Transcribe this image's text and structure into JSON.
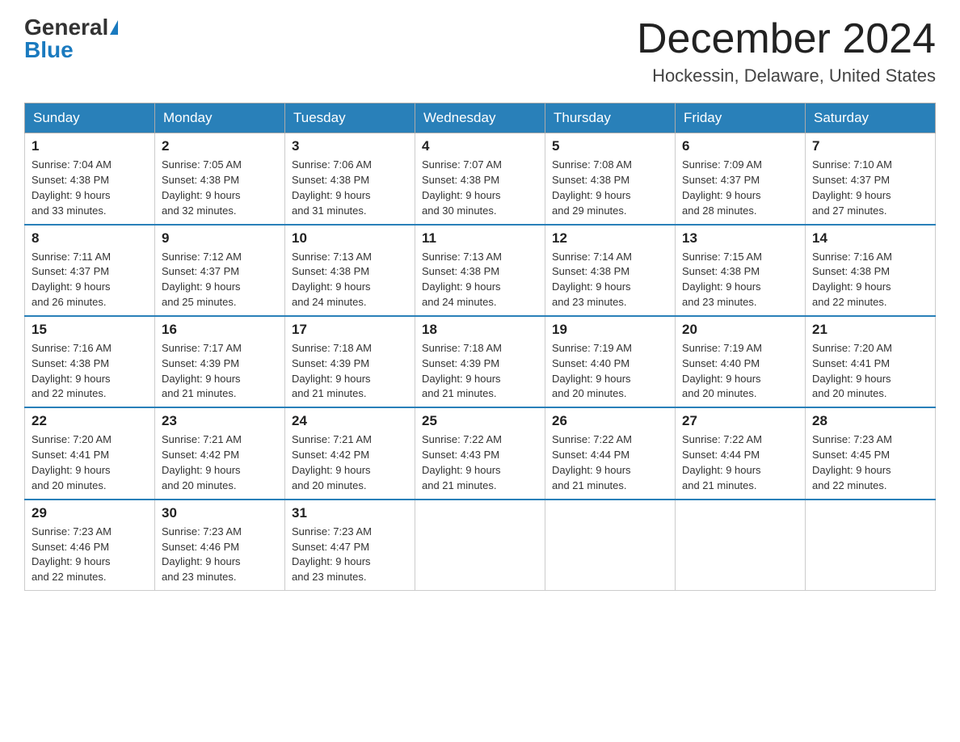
{
  "header": {
    "logo_general": "General",
    "logo_blue": "Blue",
    "month_title": "December 2024",
    "location": "Hockessin, Delaware, United States"
  },
  "weekdays": [
    "Sunday",
    "Monday",
    "Tuesday",
    "Wednesday",
    "Thursday",
    "Friday",
    "Saturday"
  ],
  "weeks": [
    [
      {
        "day": "1",
        "sunrise": "7:04 AM",
        "sunset": "4:38 PM",
        "daylight": "9 hours and 33 minutes."
      },
      {
        "day": "2",
        "sunrise": "7:05 AM",
        "sunset": "4:38 PM",
        "daylight": "9 hours and 32 minutes."
      },
      {
        "day": "3",
        "sunrise": "7:06 AM",
        "sunset": "4:38 PM",
        "daylight": "9 hours and 31 minutes."
      },
      {
        "day": "4",
        "sunrise": "7:07 AM",
        "sunset": "4:38 PM",
        "daylight": "9 hours and 30 minutes."
      },
      {
        "day": "5",
        "sunrise": "7:08 AM",
        "sunset": "4:38 PM",
        "daylight": "9 hours and 29 minutes."
      },
      {
        "day": "6",
        "sunrise": "7:09 AM",
        "sunset": "4:37 PM",
        "daylight": "9 hours and 28 minutes."
      },
      {
        "day": "7",
        "sunrise": "7:10 AM",
        "sunset": "4:37 PM",
        "daylight": "9 hours and 27 minutes."
      }
    ],
    [
      {
        "day": "8",
        "sunrise": "7:11 AM",
        "sunset": "4:37 PM",
        "daylight": "9 hours and 26 minutes."
      },
      {
        "day": "9",
        "sunrise": "7:12 AM",
        "sunset": "4:37 PM",
        "daylight": "9 hours and 25 minutes."
      },
      {
        "day": "10",
        "sunrise": "7:13 AM",
        "sunset": "4:38 PM",
        "daylight": "9 hours and 24 minutes."
      },
      {
        "day": "11",
        "sunrise": "7:13 AM",
        "sunset": "4:38 PM",
        "daylight": "9 hours and 24 minutes."
      },
      {
        "day": "12",
        "sunrise": "7:14 AM",
        "sunset": "4:38 PM",
        "daylight": "9 hours and 23 minutes."
      },
      {
        "day": "13",
        "sunrise": "7:15 AM",
        "sunset": "4:38 PM",
        "daylight": "9 hours and 23 minutes."
      },
      {
        "day": "14",
        "sunrise": "7:16 AM",
        "sunset": "4:38 PM",
        "daylight": "9 hours and 22 minutes."
      }
    ],
    [
      {
        "day": "15",
        "sunrise": "7:16 AM",
        "sunset": "4:38 PM",
        "daylight": "9 hours and 22 minutes."
      },
      {
        "day": "16",
        "sunrise": "7:17 AM",
        "sunset": "4:39 PM",
        "daylight": "9 hours and 21 minutes."
      },
      {
        "day": "17",
        "sunrise": "7:18 AM",
        "sunset": "4:39 PM",
        "daylight": "9 hours and 21 minutes."
      },
      {
        "day": "18",
        "sunrise": "7:18 AM",
        "sunset": "4:39 PM",
        "daylight": "9 hours and 21 minutes."
      },
      {
        "day": "19",
        "sunrise": "7:19 AM",
        "sunset": "4:40 PM",
        "daylight": "9 hours and 20 minutes."
      },
      {
        "day": "20",
        "sunrise": "7:19 AM",
        "sunset": "4:40 PM",
        "daylight": "9 hours and 20 minutes."
      },
      {
        "day": "21",
        "sunrise": "7:20 AM",
        "sunset": "4:41 PM",
        "daylight": "9 hours and 20 minutes."
      }
    ],
    [
      {
        "day": "22",
        "sunrise": "7:20 AM",
        "sunset": "4:41 PM",
        "daylight": "9 hours and 20 minutes."
      },
      {
        "day": "23",
        "sunrise": "7:21 AM",
        "sunset": "4:42 PM",
        "daylight": "9 hours and 20 minutes."
      },
      {
        "day": "24",
        "sunrise": "7:21 AM",
        "sunset": "4:42 PM",
        "daylight": "9 hours and 20 minutes."
      },
      {
        "day": "25",
        "sunrise": "7:22 AM",
        "sunset": "4:43 PM",
        "daylight": "9 hours and 21 minutes."
      },
      {
        "day": "26",
        "sunrise": "7:22 AM",
        "sunset": "4:44 PM",
        "daylight": "9 hours and 21 minutes."
      },
      {
        "day": "27",
        "sunrise": "7:22 AM",
        "sunset": "4:44 PM",
        "daylight": "9 hours and 21 minutes."
      },
      {
        "day": "28",
        "sunrise": "7:23 AM",
        "sunset": "4:45 PM",
        "daylight": "9 hours and 22 minutes."
      }
    ],
    [
      {
        "day": "29",
        "sunrise": "7:23 AM",
        "sunset": "4:46 PM",
        "daylight": "9 hours and 22 minutes."
      },
      {
        "day": "30",
        "sunrise": "7:23 AM",
        "sunset": "4:46 PM",
        "daylight": "9 hours and 23 minutes."
      },
      {
        "day": "31",
        "sunrise": "7:23 AM",
        "sunset": "4:47 PM",
        "daylight": "9 hours and 23 minutes."
      },
      null,
      null,
      null,
      null
    ]
  ]
}
